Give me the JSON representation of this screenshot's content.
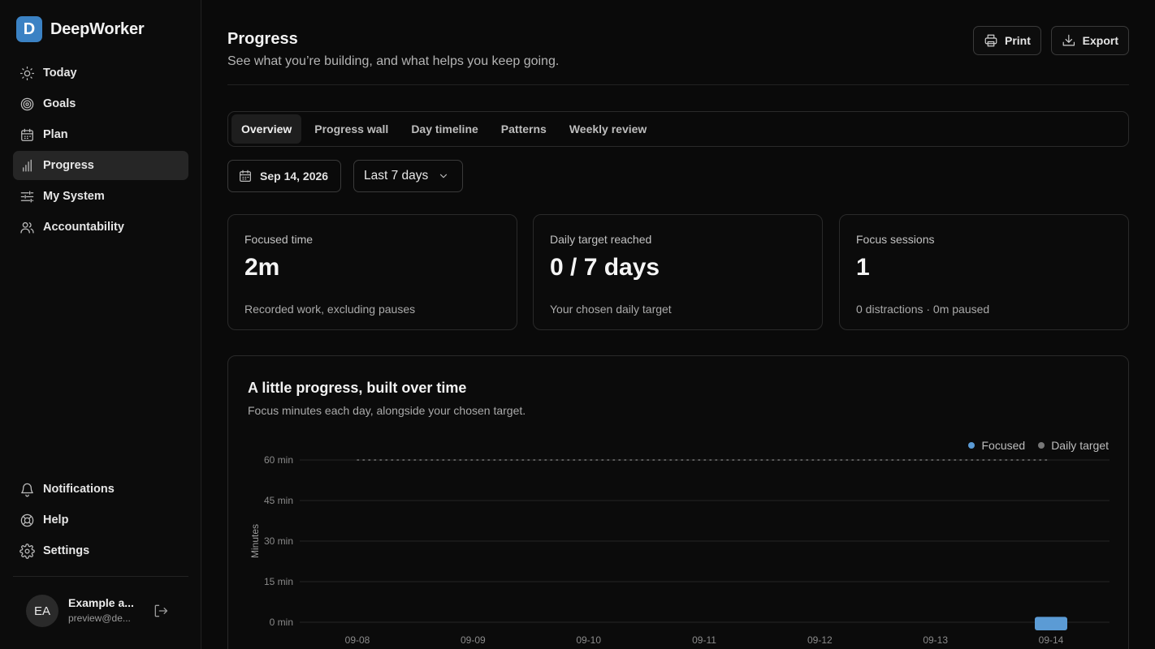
{
  "app": {
    "name": "DeepWorker",
    "logo_letter": "D",
    "accent": "#3b82c4"
  },
  "sidebar": {
    "items": [
      {
        "label": "Today",
        "icon": "sun-icon"
      },
      {
        "label": "Goals",
        "icon": "target-icon"
      },
      {
        "label": "Plan",
        "icon": "calendar-icon"
      },
      {
        "label": "Progress",
        "icon": "bar-chart-icon",
        "active": true
      },
      {
        "label": "My System",
        "icon": "sliders-icon"
      },
      {
        "label": "Accountability",
        "icon": "users-icon"
      }
    ],
    "bottom_items": [
      {
        "label": "Notifications",
        "icon": "bell-icon"
      },
      {
        "label": "Help",
        "icon": "lifebuoy-icon"
      },
      {
        "label": "Settings",
        "icon": "gear-icon"
      }
    ],
    "account": {
      "initials": "EA",
      "name": "Example a...",
      "email": "preview@de..."
    }
  },
  "header": {
    "title": "Progress",
    "subtitle": "See what you’re building, and what helps you keep going.",
    "print_label": "Print",
    "export_label": "Export"
  },
  "tabs": [
    {
      "label": "Overview",
      "active": true
    },
    {
      "label": "Progress wall"
    },
    {
      "label": "Day timeline"
    },
    {
      "label": "Patterns"
    },
    {
      "label": "Weekly review"
    }
  ],
  "filters": {
    "date": "Sep 14, 2026",
    "range": "Last 7 days"
  },
  "stats": [
    {
      "label": "Focused time",
      "value": "2m",
      "note": "Recorded work, excluding pauses"
    },
    {
      "label": "Daily target reached",
      "value": "0 / 7 days",
      "note": "Your chosen daily target"
    },
    {
      "label": "Focus sessions",
      "value": "1",
      "note": "0 distractions · 0m paused"
    }
  ],
  "chart": {
    "title": "A little progress, built over time",
    "subtitle": "Focus minutes each day, alongside your chosen target."
  },
  "chart_data": {
    "type": "bar",
    "categories": [
      "09-08",
      "09-09",
      "09-10",
      "09-11",
      "09-12",
      "09-13",
      "09-14"
    ],
    "series": [
      {
        "name": "Focused",
        "values": [
          0,
          0,
          0,
          0,
          0,
          0,
          2
        ],
        "color": "#5b9bd5"
      },
      {
        "name": "Daily target",
        "values": [
          60,
          60,
          60,
          60,
          60,
          60,
          60
        ],
        "color": "#777777",
        "style": "dotted-line"
      }
    ],
    "ylabel": "Minutes",
    "yticks": [
      "0 min",
      "15 min",
      "30 min",
      "45 min",
      "60 min"
    ],
    "ylim": [
      0,
      60
    ],
    "grid": true,
    "legend": "top-right"
  }
}
